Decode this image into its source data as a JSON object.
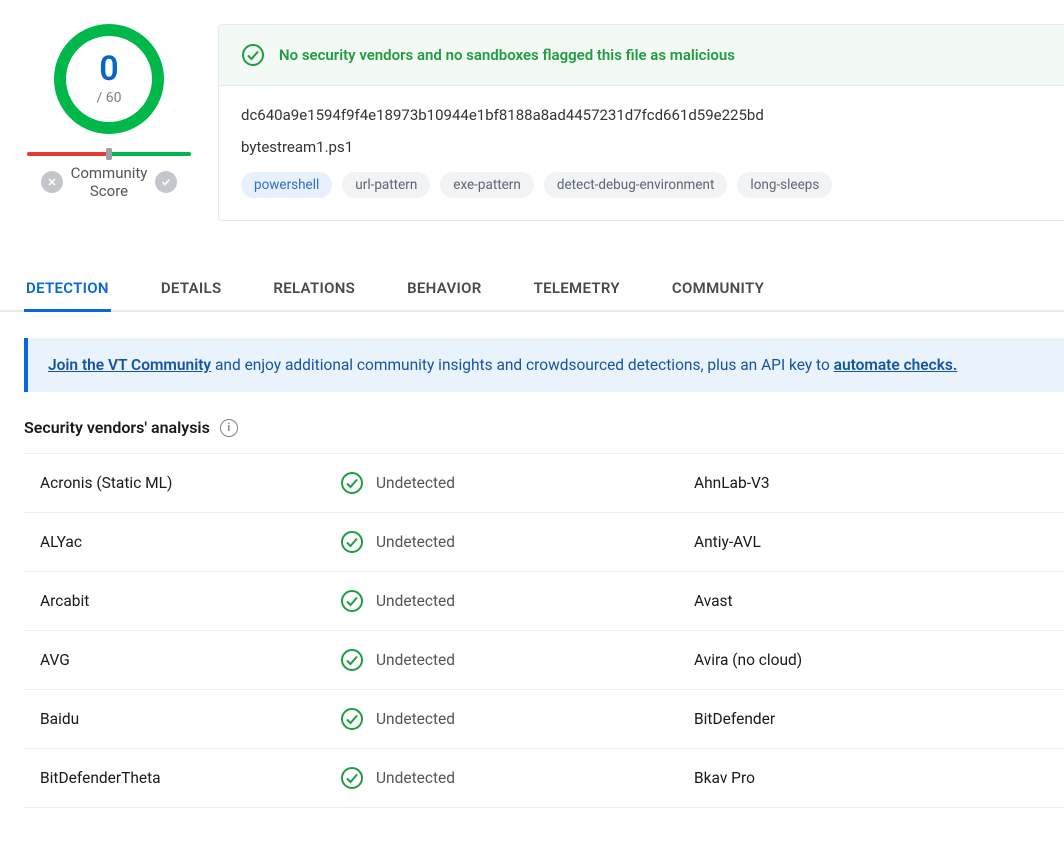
{
  "score": {
    "value": "0",
    "denominator": "/ 60"
  },
  "community_score_label": "Community\nScore",
  "banner_text": "No security vendors and no sandboxes flagged this file as malicious",
  "hash": "dc640a9e1594f9f4e18973b10944e1bf8188a8ad4457231d7fcd661d59e225bd",
  "filename": "bytestream1.ps1",
  "tags": [
    {
      "label": "powershell",
      "highlight": true
    },
    {
      "label": "url-pattern",
      "highlight": false
    },
    {
      "label": "exe-pattern",
      "highlight": false
    },
    {
      "label": "detect-debug-environment",
      "highlight": false
    },
    {
      "label": "long-sleeps",
      "highlight": false
    }
  ],
  "tabs": [
    {
      "label": "DETECTION",
      "active": true
    },
    {
      "label": "DETAILS",
      "active": false
    },
    {
      "label": "RELATIONS",
      "active": false
    },
    {
      "label": "BEHAVIOR",
      "active": false
    },
    {
      "label": "TELEMETRY",
      "active": false
    },
    {
      "label": "COMMUNITY",
      "active": false
    }
  ],
  "join": {
    "link1": "Join the VT Community",
    "mid": " and enjoy additional community insights and crowdsourced detections, plus an API key to ",
    "link2": "automate checks."
  },
  "sv_heading": "Security vendors' analysis",
  "vendors": [
    {
      "left": "Acronis (Static ML)",
      "status": "Undetected",
      "right": "AhnLab-V3"
    },
    {
      "left": "ALYac",
      "status": "Undetected",
      "right": "Antiy-AVL"
    },
    {
      "left": "Arcabit",
      "status": "Undetected",
      "right": "Avast"
    },
    {
      "left": "AVG",
      "status": "Undetected",
      "right": "Avira (no cloud)"
    },
    {
      "left": "Baidu",
      "status": "Undetected",
      "right": "BitDefender"
    },
    {
      "left": "BitDefenderTheta",
      "status": "Undetected",
      "right": "Bkav Pro"
    }
  ]
}
